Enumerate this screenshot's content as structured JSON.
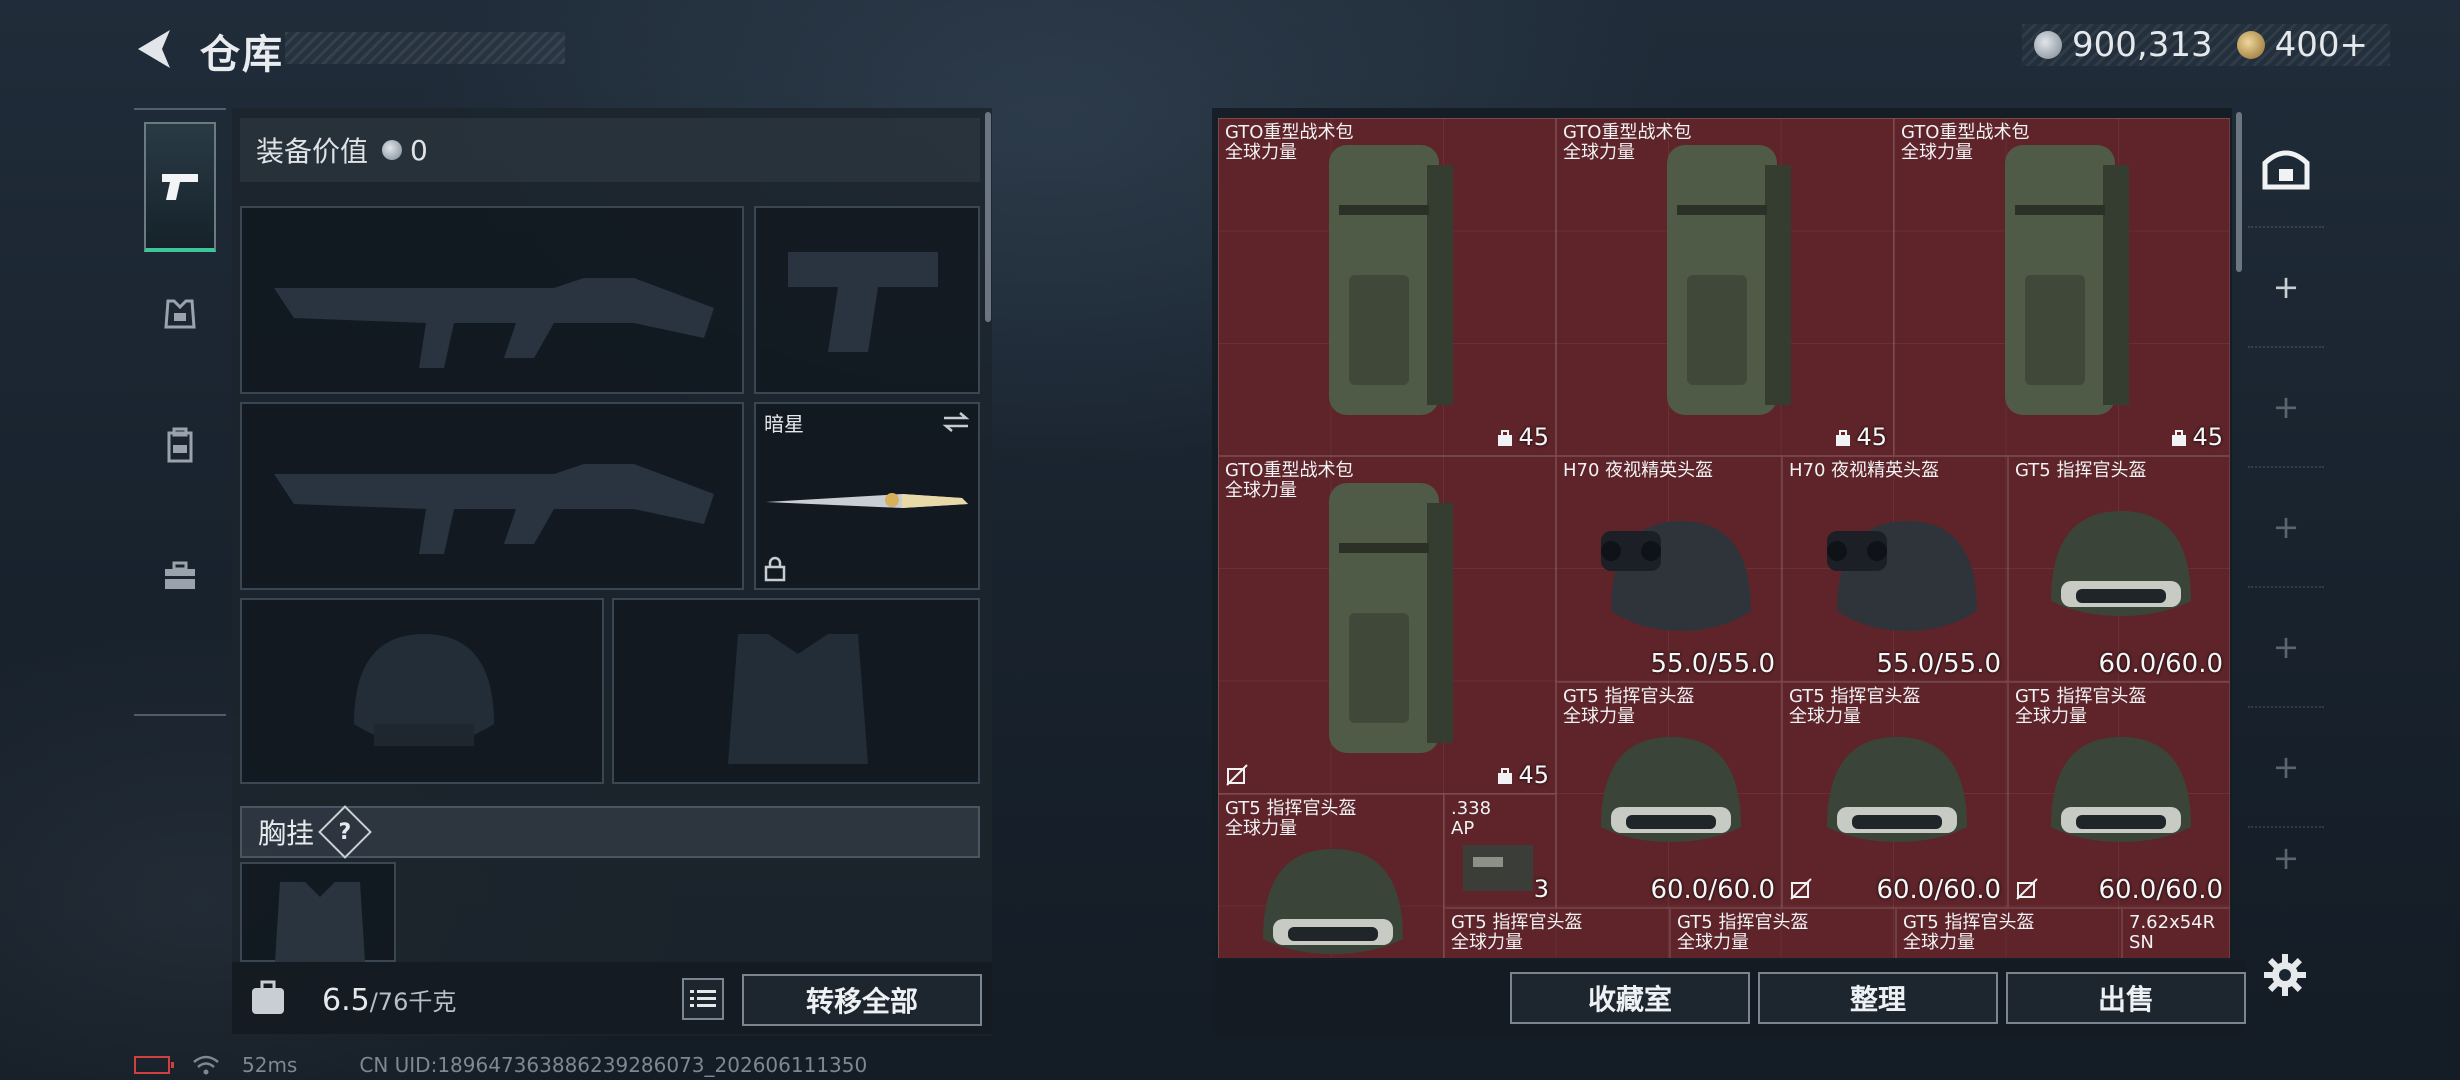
{
  "header": {
    "title": "仓库",
    "currency": [
      {
        "icon": "silver-coin-icon",
        "value": "900,313"
      },
      {
        "icon": "gold-coin-icon",
        "value": "400+"
      }
    ]
  },
  "tabs": [
    {
      "icon": "pistol-icon",
      "active": true
    },
    {
      "icon": "armor-vest-icon",
      "active": false
    },
    {
      "icon": "backpack-icon",
      "active": false
    },
    {
      "icon": "toolbox-icon",
      "active": false
    }
  ],
  "equipment": {
    "value_label": "装备价值",
    "value": "0",
    "melee_slot_label": "暗星",
    "chest_label": "胸挂",
    "help": "?"
  },
  "footer_left": {
    "weight_current": "6.5",
    "weight_max": "/76千克",
    "transfer_all": "转移全部"
  },
  "inventory": {
    "items": [
      {
        "name": "GTO重型战术包",
        "sub": "全球力量",
        "value": "45"
      },
      {
        "name": "GTO重型战术包",
        "sub": "全球力量",
        "value": "45"
      },
      {
        "name": "GTO重型战术包",
        "sub": "全球力量",
        "value": "45"
      },
      {
        "name": "GTO重型战术包",
        "sub": "全球力量",
        "value": "45"
      },
      {
        "name": "H70 夜视精英头盔",
        "sub": "",
        "value": "55.0/55.0"
      },
      {
        "name": "H70 夜视精英头盔",
        "sub": "",
        "value": "55.0/55.0"
      },
      {
        "name": "GT5 指挥官头盔",
        "sub": "",
        "value": "60.0/60.0"
      },
      {
        "name": "GT5 指挥官头盔",
        "sub": "全球力量",
        "value": "60.0/60.0"
      },
      {
        "name": "GT5 指挥官头盔",
        "sub": "全球力量",
        "value": "60.0/60.0"
      },
      {
        "name": "GT5 指挥官头盔",
        "sub": "全球力量",
        "value": "60.0/60.0"
      },
      {
        "name": "GT5 指挥官头盔",
        "sub": "全球力量",
        "value": ""
      },
      {
        "name": ".338",
        "sub": "AP",
        "value": "3"
      },
      {
        "name": "GT5 指挥官头盔",
        "sub": "全球力量",
        "value": ""
      },
      {
        "name": "GT5 指挥官头盔",
        "sub": "全球力量",
        "value": ""
      },
      {
        "name": "GT5 指挥官头盔",
        "sub": "全球力量",
        "value": ""
      },
      {
        "name": "7.62x54R",
        "sub": "SN",
        "value": ""
      }
    ]
  },
  "footer_right": {
    "collection": "收藏室",
    "sort": "整理",
    "sell": "出售"
  },
  "status": {
    "ping": "52ms",
    "uid": "CN UID:1896473638862392860​73_202606111350"
  }
}
